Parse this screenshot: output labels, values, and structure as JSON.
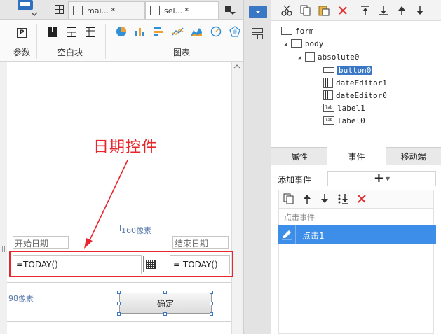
{
  "tabs": [
    {
      "label": "mai... *"
    },
    {
      "label": "sel... *"
    }
  ],
  "toolbar": {
    "groups": [
      {
        "label": "参数"
      },
      {
        "label": "空白块"
      },
      {
        "label": "图表"
      }
    ]
  },
  "canvas": {
    "callout": "日期控件",
    "dim_top": "160像素",
    "dim_left": "98像素",
    "start_label": "开始日期",
    "end_label": "结束日期",
    "start_value": "=TODAY()",
    "end_value": "= TODAY()",
    "confirm_label": "确定"
  },
  "tree": {
    "items": [
      {
        "label": "form"
      },
      {
        "label": "body"
      },
      {
        "label": "absolute0"
      },
      {
        "label": "button0"
      },
      {
        "label": "dateEditor1"
      },
      {
        "label": "dateEditor0"
      },
      {
        "label": "label1"
      },
      {
        "label": "label0"
      }
    ]
  },
  "bottom_tabs": [
    {
      "label": "属性"
    },
    {
      "label": "事件"
    },
    {
      "label": "移动端"
    }
  ],
  "events": {
    "add_label": "添加事件",
    "add_symbol": "+",
    "section_label": "点击事件",
    "items": [
      {
        "label": "点击1"
      }
    ]
  },
  "colors": {
    "accent": "#3a78c6",
    "annotation": "#e8262c",
    "selected_row": "#3d8ee8"
  }
}
